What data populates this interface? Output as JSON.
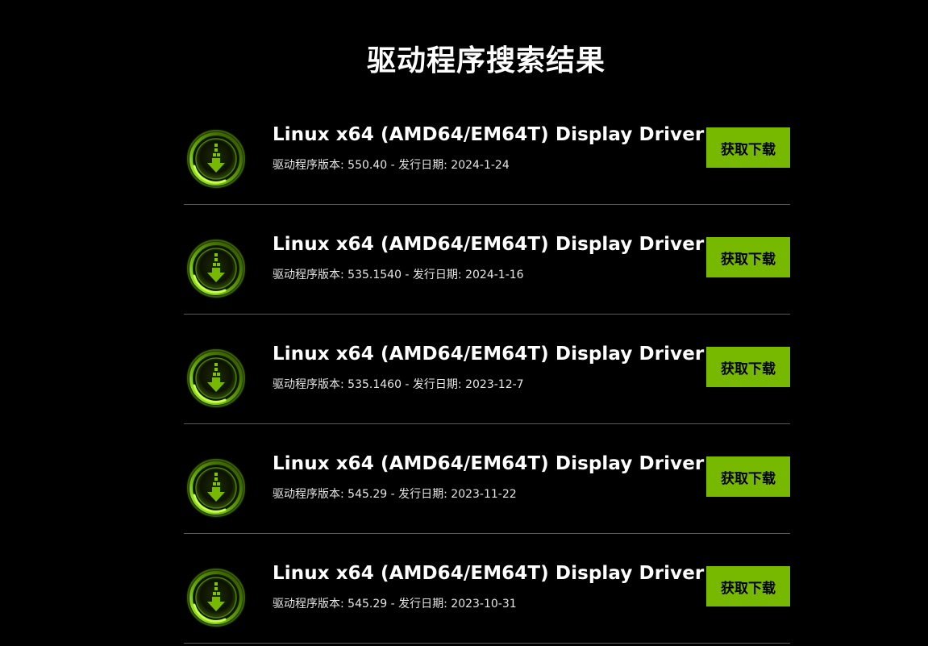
{
  "page": {
    "title": "驱动程序搜索结果"
  },
  "labels": {
    "version_prefix": "驱动程序版本: ",
    "date_prefix": " - 发行日期: "
  },
  "colors": {
    "background": "#000000",
    "accent": "#76b900",
    "divider": "#5a5a5a",
    "text": "#ffffff"
  },
  "results": [
    {
      "icon": "download-arrow-icon",
      "name": "Linux x64 (AMD64/EM64T) Display Driver",
      "version": "550.40",
      "date": "2024-1-24",
      "button_label": "获取下载"
    },
    {
      "icon": "download-arrow-icon",
      "name": "Linux x64 (AMD64/EM64T) Display Driver",
      "version": "535.1540",
      "date": "2024-1-16",
      "button_label": "获取下载"
    },
    {
      "icon": "download-arrow-icon",
      "name": "Linux x64 (AMD64/EM64T) Display Driver",
      "version": "535.1460",
      "date": "2023-12-7",
      "button_label": "获取下载"
    },
    {
      "icon": "download-arrow-icon",
      "name": "Linux x64 (AMD64/EM64T) Display Driver",
      "version": "545.29",
      "date": "2023-11-22",
      "button_label": "获取下载"
    },
    {
      "icon": "download-arrow-icon",
      "name": "Linux x64 (AMD64/EM64T) Display Driver",
      "version": "545.29",
      "date": "2023-10-31",
      "button_label": "获取下载"
    }
  ]
}
